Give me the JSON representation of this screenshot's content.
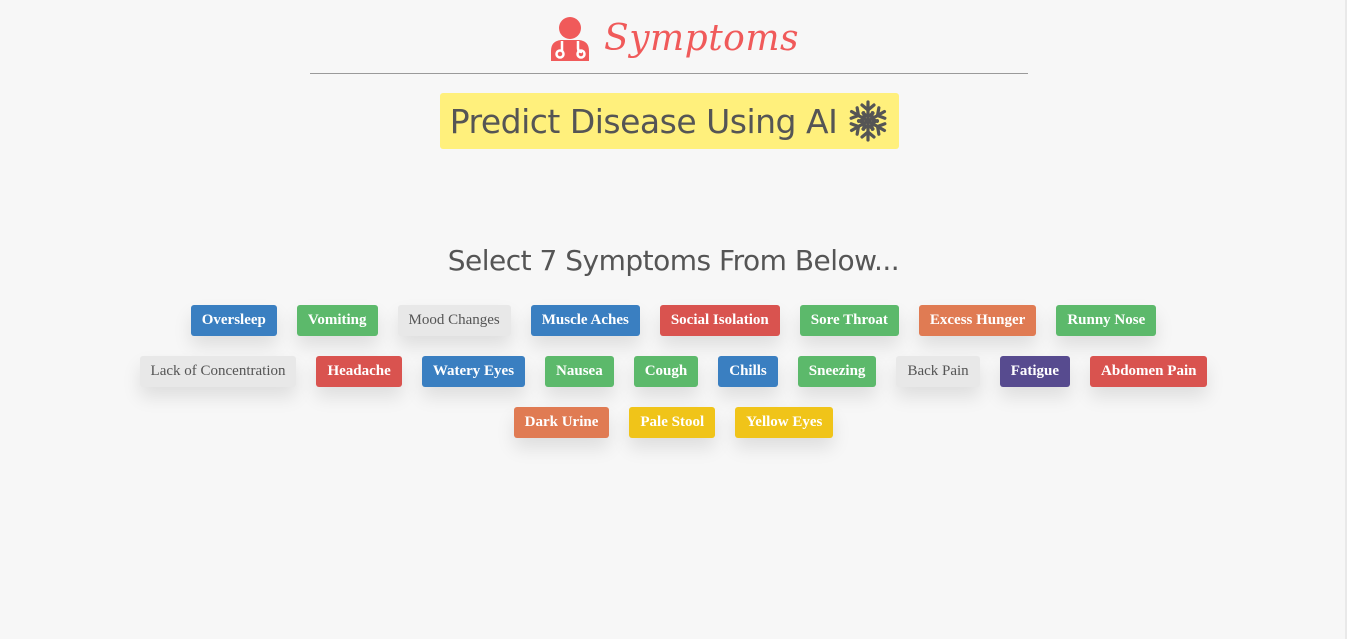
{
  "header": {
    "logo_text": "Symptoms",
    "logo_icon": "doctor-icon",
    "logo_color": "#f05a5a"
  },
  "banner": {
    "text": "Predict Disease Using AI",
    "icon": "snowflake-icon",
    "background": "#fff07c"
  },
  "instruction": "Select 7 Symptoms From Below...",
  "colors": {
    "blue": "#3a7fc1",
    "green": "#5cb96b",
    "light": "#e8e8e8",
    "red": "#d9534f",
    "orange": "#e07b53",
    "purple": "#574b8f",
    "yellow": "#f0c419"
  },
  "symptom_rows": [
    [
      {
        "label": "Oversleep",
        "color": "#3a7fc1"
      },
      {
        "label": "Vomiting",
        "color": "#5cb96b"
      },
      {
        "label": "Mood Changes",
        "color": "#e8e8e8"
      },
      {
        "label": "Muscle Aches",
        "color": "#3a7fc1"
      },
      {
        "label": "Social Isolation",
        "color": "#d9534f"
      },
      {
        "label": "Sore Throat",
        "color": "#5cb96b"
      },
      {
        "label": "Excess Hunger",
        "color": "#e07b53"
      },
      {
        "label": "Runny Nose",
        "color": "#5cb96b"
      }
    ],
    [
      {
        "label": "Lack of Concentration",
        "color": "#e8e8e8"
      },
      {
        "label": "Headache",
        "color": "#d9534f"
      },
      {
        "label": "Watery Eyes",
        "color": "#3a7fc1"
      },
      {
        "label": "Nausea",
        "color": "#5cb96b"
      },
      {
        "label": "Cough",
        "color": "#5cb96b"
      },
      {
        "label": "Chills",
        "color": "#3a7fc1"
      },
      {
        "label": "Sneezing",
        "color": "#5cb96b"
      },
      {
        "label": "Back Pain",
        "color": "#e8e8e8"
      },
      {
        "label": "Fatigue",
        "color": "#574b8f"
      },
      {
        "label": "Abdomen Pain",
        "color": "#d9534f"
      }
    ],
    [
      {
        "label": "Dark Urine",
        "color": "#e07b53"
      },
      {
        "label": "Pale Stool",
        "color": "#f0c419"
      },
      {
        "label": "Yellow Eyes",
        "color": "#f0c419"
      }
    ]
  ]
}
